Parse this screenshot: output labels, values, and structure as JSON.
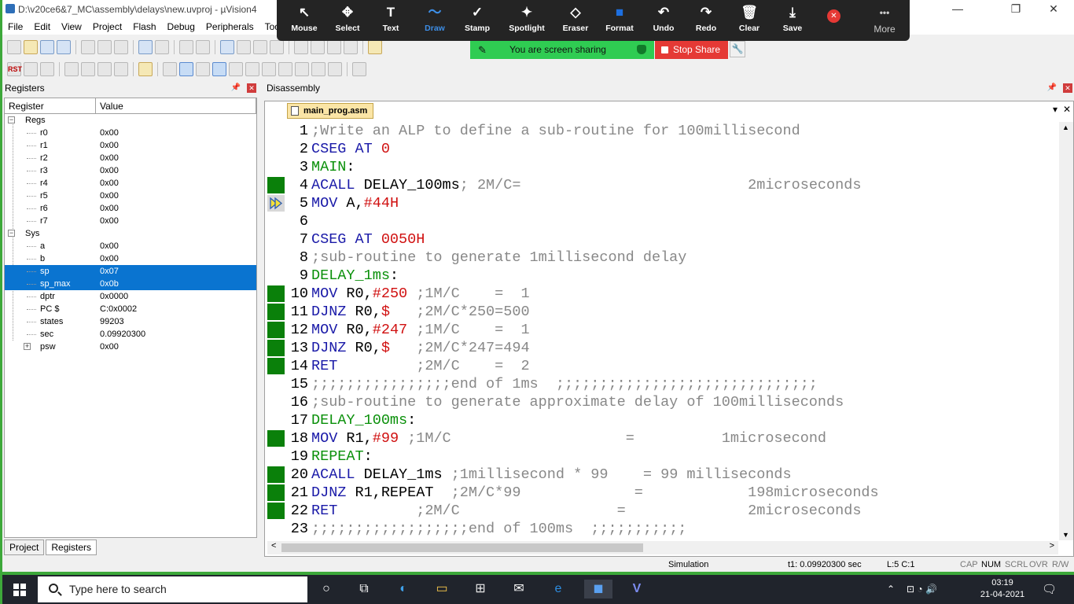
{
  "window": {
    "title": "D:\\v20ce6&7_MC\\assembly\\delays\\new.uvproj - µVision4",
    "min": "—",
    "max": "❐",
    "close": "✕"
  },
  "menu": [
    "File",
    "Edit",
    "View",
    "Project",
    "Flash",
    "Debug",
    "Peripherals",
    "Tools"
  ],
  "toolbar": {
    "rst_label": "RST"
  },
  "zoom": {
    "items": [
      {
        "icon": "↖",
        "label": "Mouse"
      },
      {
        "icon": "✥",
        "label": "Select"
      },
      {
        "icon": "T",
        "label": "Text"
      },
      {
        "icon": "〜",
        "label": "Draw"
      },
      {
        "icon": "✓",
        "label": "Stamp"
      },
      {
        "icon": "✦",
        "label": "Spotlight"
      },
      {
        "icon": "◇",
        "label": "Eraser"
      },
      {
        "icon": "■",
        "label": "Format"
      },
      {
        "icon": "↶",
        "label": "Undo"
      },
      {
        "icon": "↷",
        "label": "Redo"
      },
      {
        "icon": "🗑",
        "label": "Clear"
      },
      {
        "icon": "⤓",
        "label": "Save"
      }
    ],
    "close": "✕",
    "more_icon": "•••",
    "more_label": "More",
    "banner": "You are screen sharing",
    "stop": "Stop Share"
  },
  "registers": {
    "panel_title": "Registers",
    "pin": "📌",
    "close": "✕",
    "col_register": "Register",
    "col_value": "Value",
    "groups": [
      {
        "name": "Regs",
        "rows": [
          {
            "name": "r0",
            "value": "0x00"
          },
          {
            "name": "r1",
            "value": "0x00"
          },
          {
            "name": "r2",
            "value": "0x00"
          },
          {
            "name": "r3",
            "value": "0x00"
          },
          {
            "name": "r4",
            "value": "0x00"
          },
          {
            "name": "r5",
            "value": "0x00"
          },
          {
            "name": "r6",
            "value": "0x00"
          },
          {
            "name": "r7",
            "value": "0x00"
          }
        ]
      },
      {
        "name": "Sys",
        "rows": [
          {
            "name": "a",
            "value": "0x00"
          },
          {
            "name": "b",
            "value": "0x00"
          },
          {
            "name": "sp",
            "value": "0x07"
          },
          {
            "name": "sp_max",
            "value": "0x0b"
          },
          {
            "name": "dptr",
            "value": "0x0000"
          },
          {
            "name": "PC  $",
            "value": "C:0x0002"
          },
          {
            "name": "states",
            "value": "99203"
          },
          {
            "name": "sec",
            "value": "0.09920300"
          },
          {
            "name": "psw",
            "value": "0x00"
          }
        ]
      }
    ],
    "tab_project": "Project",
    "tab_registers": "Registers"
  },
  "disassembly": {
    "panel_title": "Disassembly",
    "file_tab": "main_prog.asm",
    "pin": "📌",
    "close": "✕",
    "dropdown": "▾"
  },
  "code_lines": [
    {
      "n": "1",
      "mark": "",
      "parts": [
        {
          "c": "c",
          "t": ";Write an ALP to define a sub-routine for 100millisecond"
        }
      ]
    },
    {
      "n": "2",
      "mark": "",
      "parts": [
        {
          "c": "k",
          "t": "CSEG AT "
        },
        {
          "c": "r",
          "t": "0"
        }
      ]
    },
    {
      "n": "3",
      "mark": "",
      "parts": [
        {
          "c": "lb",
          "t": "MAIN"
        },
        {
          "c": "t",
          "t": ":"
        }
      ]
    },
    {
      "n": "4",
      "mark": "g",
      "parts": [
        {
          "c": "k",
          "t": "ACALL "
        },
        {
          "c": "t",
          "t": "DELAY_100ms"
        },
        {
          "c": "c",
          "t": "; 2M/C=                          2microseconds"
        }
      ]
    },
    {
      "n": "5",
      "mark": "arrow",
      "parts": [
        {
          "c": "k",
          "t": "MOV "
        },
        {
          "c": "t",
          "t": "A,"
        },
        {
          "c": "r",
          "t": "#44H"
        }
      ]
    },
    {
      "n": "6",
      "mark": "",
      "parts": [
        {
          "c": "t",
          "t": ""
        }
      ]
    },
    {
      "n": "7",
      "mark": "",
      "parts": [
        {
          "c": "k",
          "t": "CSEG AT "
        },
        {
          "c": "r",
          "t": "0050H"
        }
      ]
    },
    {
      "n": "8",
      "mark": "",
      "parts": [
        {
          "c": "c",
          "t": ";sub-routine to generate 1millisecond delay"
        }
      ]
    },
    {
      "n": "9",
      "mark": "",
      "parts": [
        {
          "c": "lb",
          "t": "DELAY_1ms"
        },
        {
          "c": "t",
          "t": ":"
        }
      ]
    },
    {
      "n": "10",
      "mark": "g",
      "parts": [
        {
          "c": "k",
          "t": "MOV "
        },
        {
          "c": "t",
          "t": "R0,"
        },
        {
          "c": "r",
          "t": "#250"
        },
        {
          "c": "c",
          "t": " ;1M/C    =  1"
        }
      ]
    },
    {
      "n": "11",
      "mark": "g",
      "parts": [
        {
          "c": "k",
          "t": "DJNZ "
        },
        {
          "c": "t",
          "t": "R0,"
        },
        {
          "c": "r",
          "t": "$"
        },
        {
          "c": "c",
          "t": "   ;2M/C*250=500"
        }
      ]
    },
    {
      "n": "12",
      "mark": "g",
      "parts": [
        {
          "c": "k",
          "t": "MOV "
        },
        {
          "c": "t",
          "t": "R0,"
        },
        {
          "c": "r",
          "t": "#247"
        },
        {
          "c": "c",
          "t": " ;1M/C    =  1"
        }
      ]
    },
    {
      "n": "13",
      "mark": "g",
      "parts": [
        {
          "c": "k",
          "t": "DJNZ "
        },
        {
          "c": "t",
          "t": "R0,"
        },
        {
          "c": "r",
          "t": "$"
        },
        {
          "c": "c",
          "t": "   ;2M/C*247=494"
        }
      ]
    },
    {
      "n": "14",
      "mark": "g",
      "parts": [
        {
          "c": "k",
          "t": "RET"
        },
        {
          "c": "c",
          "t": "         ;2M/C    =  2"
        }
      ]
    },
    {
      "n": "15",
      "mark": "",
      "parts": [
        {
          "c": "c",
          "t": ";;;;;;;;;;;;;;;;end of 1ms  ;;;;;;;;;;;;;;;;;;;;;;;;;;;;;;"
        }
      ]
    },
    {
      "n": "16",
      "mark": "",
      "parts": [
        {
          "c": "c",
          "t": ";sub-routine to generate approximate delay of 100milliseconds"
        }
      ]
    },
    {
      "n": "17",
      "mark": "",
      "parts": [
        {
          "c": "lb",
          "t": "DELAY_100ms"
        },
        {
          "c": "t",
          "t": ":"
        }
      ]
    },
    {
      "n": "18",
      "mark": "g",
      "parts": [
        {
          "c": "k",
          "t": "MOV "
        },
        {
          "c": "t",
          "t": "R1,"
        },
        {
          "c": "r",
          "t": "#99"
        },
        {
          "c": "c",
          "t": " ;1M/C                    =          1microsecond"
        }
      ]
    },
    {
      "n": "19",
      "mark": "",
      "parts": [
        {
          "c": "lb",
          "t": "REPEAT"
        },
        {
          "c": "t",
          "t": ":"
        }
      ]
    },
    {
      "n": "20",
      "mark": "g",
      "parts": [
        {
          "c": "k",
          "t": "ACALL "
        },
        {
          "c": "t",
          "t": "DELAY_1ms"
        },
        {
          "c": "c",
          "t": " ;1millisecond * 99    = 99 milliseconds"
        }
      ]
    },
    {
      "n": "21",
      "mark": "g",
      "parts": [
        {
          "c": "k",
          "t": "DJNZ "
        },
        {
          "c": "t",
          "t": "R1,REPEAT"
        },
        {
          "c": "c",
          "t": "  ;2M/C*99             =            198microseconds"
        }
      ]
    },
    {
      "n": "22",
      "mark": "g",
      "parts": [
        {
          "c": "k",
          "t": "RET"
        },
        {
          "c": "c",
          "t": "         ;2M/C                  =              2microseconds"
        }
      ]
    },
    {
      "n": "23",
      "mark": "",
      "parts": [
        {
          "c": "c",
          "t": ";;;;;;;;;;;;;;;;;;end of 100ms  ;;;;;;;;;;;"
        }
      ]
    }
  ],
  "scroll": {
    "up": "▲",
    "down": "▼",
    "left": "<",
    "right": ">"
  },
  "status": {
    "mode": "Simulation",
    "time": "t1: 0.09920300 sec",
    "pos": "L:5 C:1",
    "cap": "CAP",
    "num": "NUM",
    "scrl": "SCRL",
    "ovr": "OVR",
    "rw": "R/W"
  },
  "taskbar": {
    "search_placeholder": "Type here to search",
    "tray_chevron": "⌃",
    "tray_icons": "⊡  ◔  🔊",
    "time": "03:19",
    "date": "21-04-2021",
    "notif": "🗨"
  },
  "colors": {
    "accent": "#0a74d0",
    "green_bg": "#3da83a",
    "breakpoint": "#0a800a"
  }
}
